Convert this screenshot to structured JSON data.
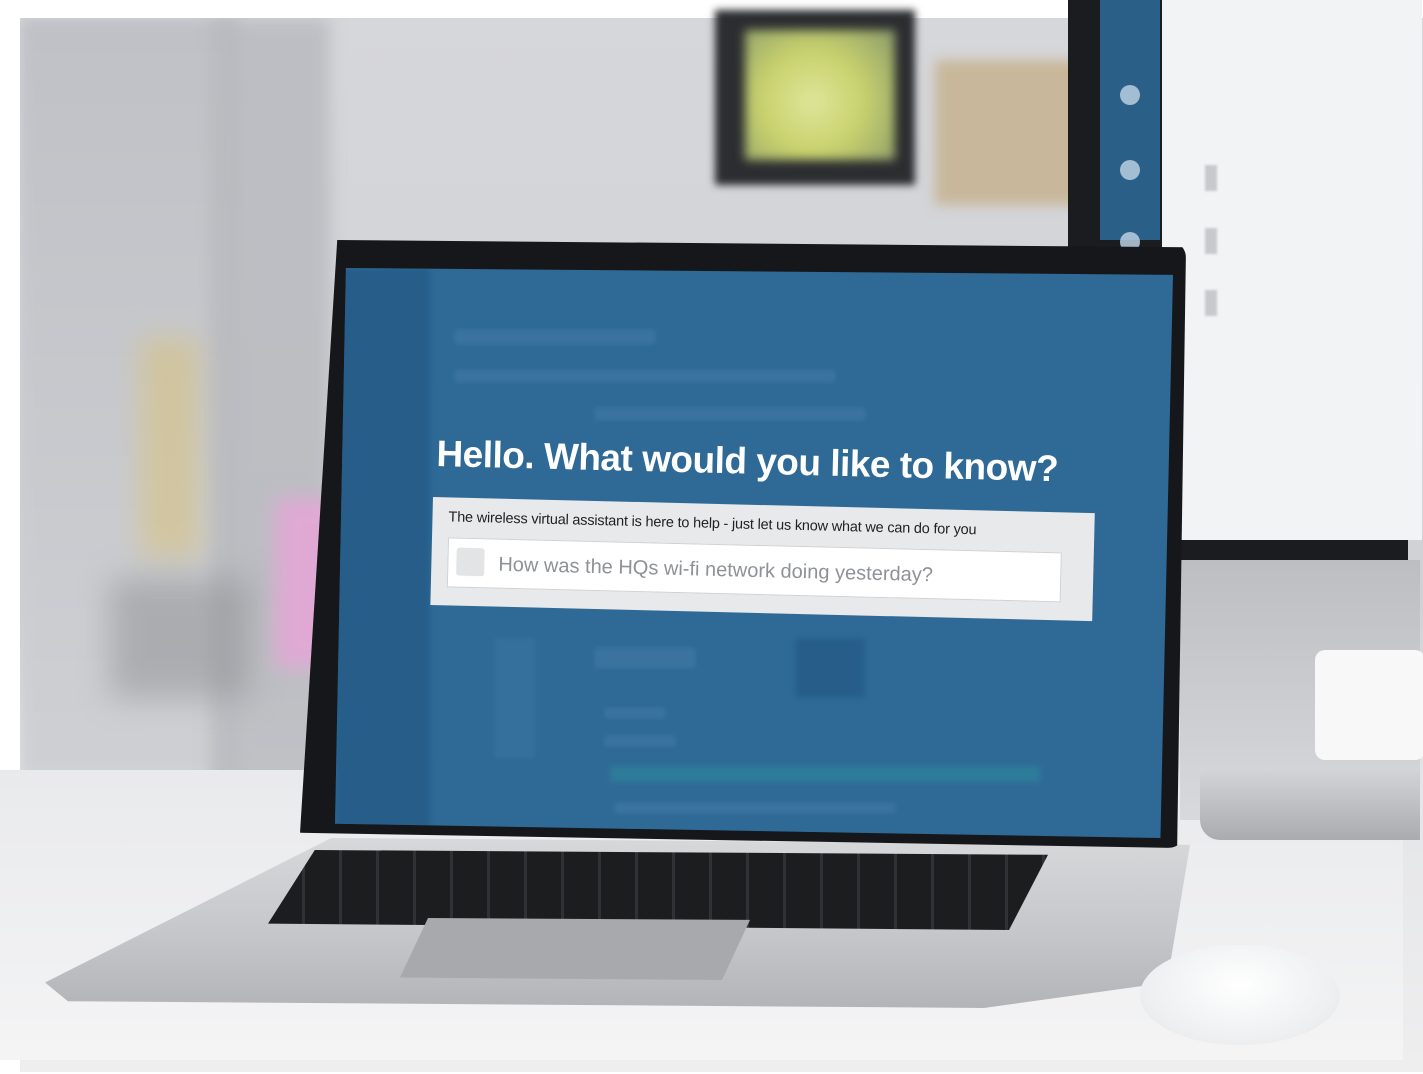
{
  "assistant": {
    "title": "Hello. What would you like to know?",
    "subtitle": "The wireless virtual assistant is here to help - just let us know what we can do for you",
    "search": {
      "placeholder": "How was the HQs wi-fi network doing yesterday?",
      "icon": "search-icon"
    }
  },
  "monitor": {
    "sidebar_icons": [
      "lightbulb-icon",
      "location-icon",
      "gear-icon"
    ]
  },
  "colors": {
    "screen_blue": "#2f6a97",
    "sidebar_blue": "#2a5f88",
    "link_blue": "#3a8fd0"
  }
}
